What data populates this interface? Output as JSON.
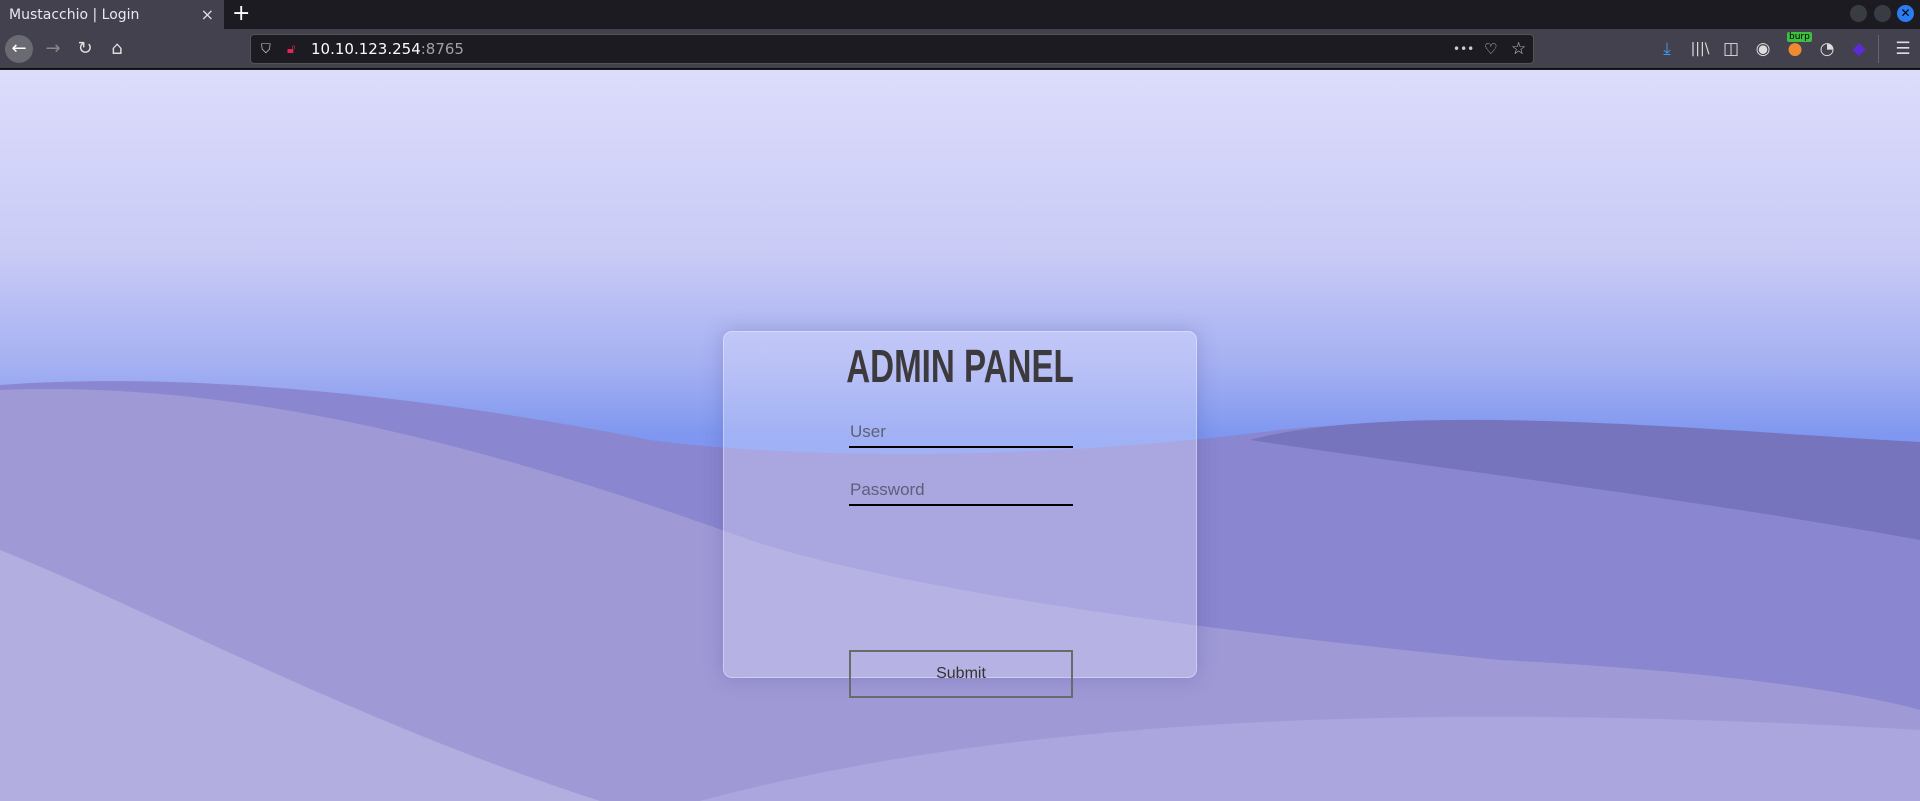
{
  "tab": {
    "title": "Mustacchio | Login",
    "close": "×",
    "new_tab": "+"
  },
  "window_controls": {
    "close": "✕"
  },
  "nav": {
    "back": "←",
    "forward": "→",
    "reload": "↻",
    "home": "⌂"
  },
  "address": {
    "host": "10.10.123.254",
    "port": ":8765",
    "more": "•••"
  },
  "extensions": {
    "burp_badge": "burp"
  },
  "login": {
    "title": "ADMIN PANEL",
    "user_placeholder": "User",
    "password_placeholder": "Password",
    "submit_label": "Submit"
  }
}
